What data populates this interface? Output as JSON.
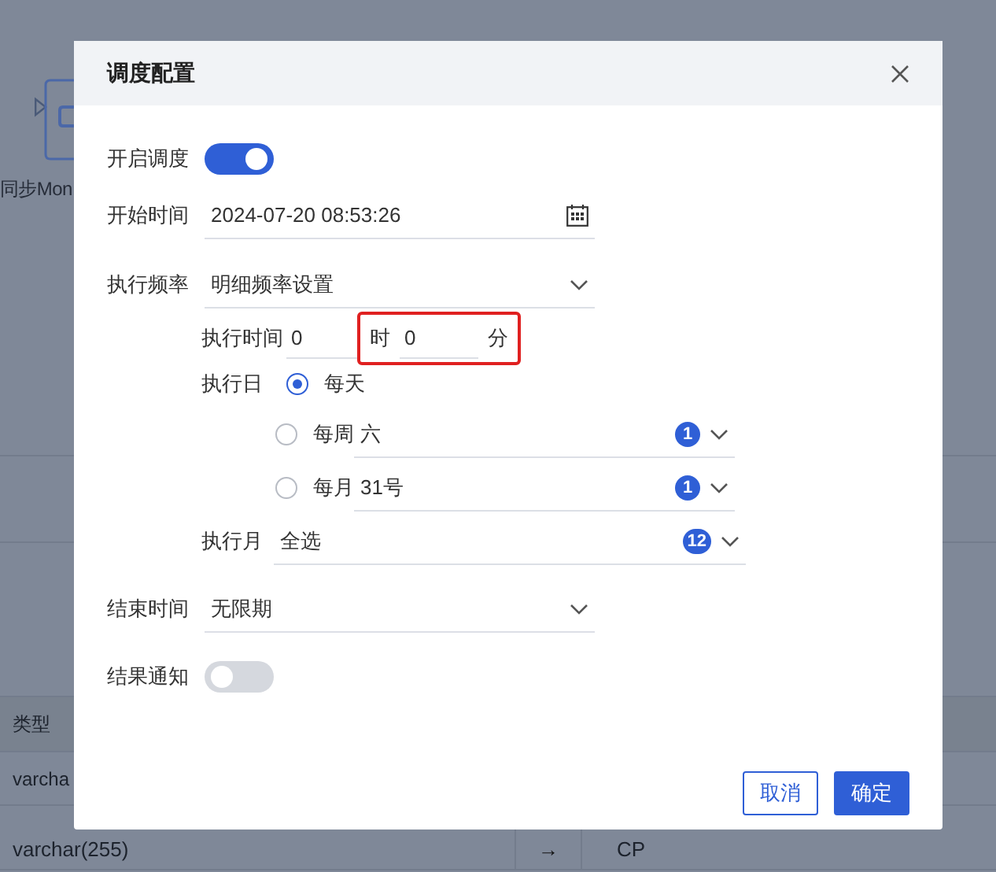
{
  "background": {
    "node_label": "同步Mon",
    "table": {
      "header": "类型",
      "rows": [
        {
          "type": "varcha"
        },
        {
          "type": "varchar(255)",
          "arrow": "→",
          "target": "CP"
        }
      ]
    }
  },
  "dialog": {
    "title": "调度配置",
    "enable": {
      "label": "开启调度",
      "on": true
    },
    "start_time": {
      "label": "开始时间",
      "value": "2024-07-20 08:53:26"
    },
    "frequency": {
      "label": "执行频率",
      "value": "明细频率设置"
    },
    "exec_time": {
      "label": "执行时间",
      "hour": "0",
      "hour_unit": "时",
      "minute": "0",
      "minute_unit": "分",
      "highlighted": true
    },
    "exec_day": {
      "label": "执行日",
      "options": [
        {
          "label": "每天",
          "selected": true
        },
        {
          "label": "每周",
          "selected": false,
          "value": "六",
          "count": "1"
        },
        {
          "label": "每月",
          "selected": false,
          "value": "31号",
          "count": "1"
        }
      ]
    },
    "exec_month": {
      "label": "执行月",
      "value": "全选",
      "count": "12"
    },
    "end_time": {
      "label": "结束时间",
      "value": "无限期"
    },
    "notify": {
      "label": "结果通知",
      "on": false
    },
    "buttons": [
      {
        "label": "取消",
        "kind": "secondary"
      },
      {
        "label": "确定",
        "kind": "primary"
      }
    ]
  }
}
